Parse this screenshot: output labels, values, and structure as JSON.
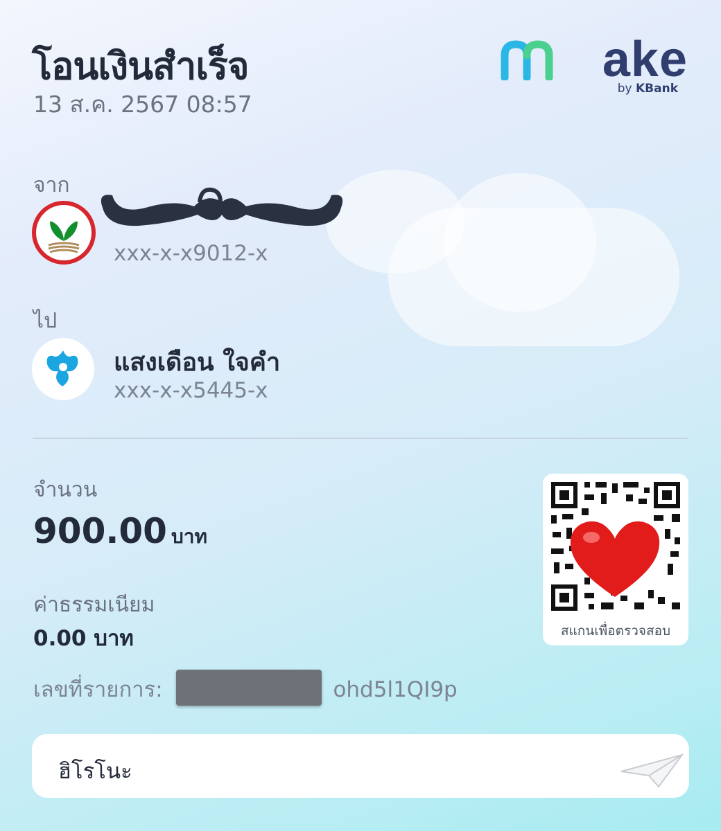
{
  "header": {
    "title": "โอนเงินสำเร็จ",
    "datetime": "13 ส.ค. 2567 08:57"
  },
  "logo": {
    "word": "ake",
    "by": "by",
    "bank": "KBank"
  },
  "from": {
    "label": "จาก",
    "name": "",
    "account": "xxx-x-x9012-x",
    "bank_icon": "kbank-icon"
  },
  "to": {
    "label": "ไป",
    "name": "แสงเดือน ใจคำ",
    "account": "xxx-x-x5445-x",
    "bank_icon": "krungthai-icon"
  },
  "amount": {
    "label": "จำนวน",
    "value": "900.00",
    "unit": "บาท"
  },
  "fee": {
    "label": "ค่าธรรมเนียม",
    "value": "0.00 บาท"
  },
  "reference": {
    "label": "เลขที่รายการ:",
    "value_visible_suffix": "ohd5l1QI9p"
  },
  "qr": {
    "caption": "สแกนเพื่อตรวจสอบ"
  },
  "note": {
    "text": "ฮิโรโนะ"
  },
  "colors": {
    "brand_navy": "#2f3e6e",
    "kbank_green": "#138f2d",
    "krungthai_teal": "#1ba5e1",
    "text_dark": "#232a3a",
    "text_muted": "#7c8494"
  }
}
